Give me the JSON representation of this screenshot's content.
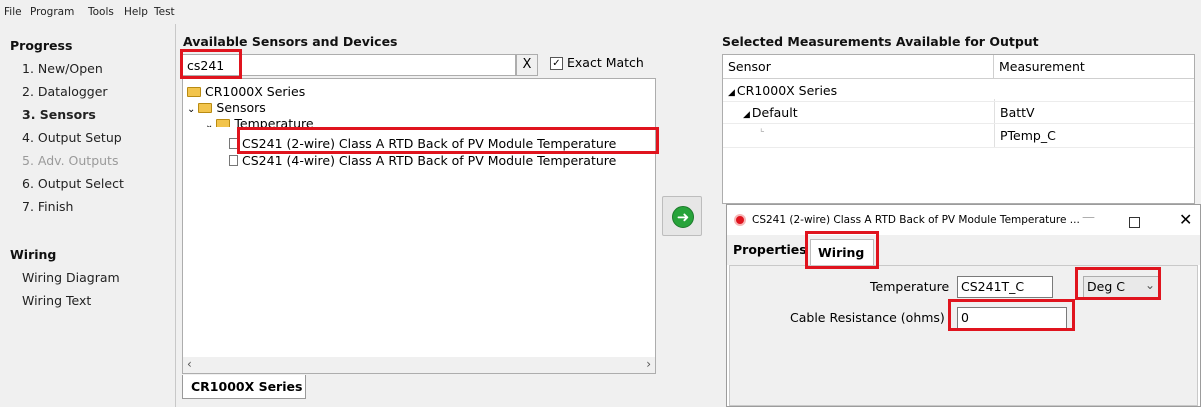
{
  "menu": [
    "File",
    "Program",
    "Tools",
    "Help",
    "Test"
  ],
  "progress": {
    "title": "Progress",
    "steps": [
      "1. New/Open",
      "2. Datalogger",
      "3. Sensors",
      "4. Output Setup",
      "5. Adv. Outputs",
      "6. Output Select",
      "7. Finish"
    ]
  },
  "wiring": {
    "title": "Wiring",
    "items": [
      "Wiring Diagram",
      "Wiring Text"
    ]
  },
  "sensors": {
    "title": "Available Sensors and Devices",
    "search_value": "cs241",
    "clear_label": "X",
    "exact_match_label": "Exact Match",
    "exact_match_check": "✓",
    "tree": {
      "root": "CR1000X Series",
      "sensors": "Sensors",
      "temperature": "Temperature",
      "item1": "CS241 (2-wire) Class A RTD Back of PV Module Temperature",
      "item2": "CS241 (4-wire) Class A RTD Back of PV Module Temperature"
    },
    "bottom_tab": "CR1000X Series"
  },
  "outputs": {
    "title": "Selected Measurements Available for Output",
    "columns": [
      "Sensor",
      "Measurement"
    ],
    "rows": [
      {
        "sensor": "CR1000X Series",
        "measurement": ""
      },
      {
        "sensor": "Default",
        "measurement": "BattV"
      },
      {
        "sensor": "",
        "measurement": "PTemp_C"
      }
    ]
  },
  "dialog": {
    "title": "CS241 (2-wire) Class A RTD Back of PV Module Temperature ...",
    "tabs": [
      "Properties",
      "Wiring"
    ],
    "temperature_label": "Temperature",
    "temperature_value": "CS241T_C",
    "unit_value": "Deg C",
    "cable_label": "Cable Resistance (ohms)",
    "cable_value": "0"
  },
  "colors": {
    "highlight": "#e0141e",
    "go_button": "#27a33a"
  }
}
